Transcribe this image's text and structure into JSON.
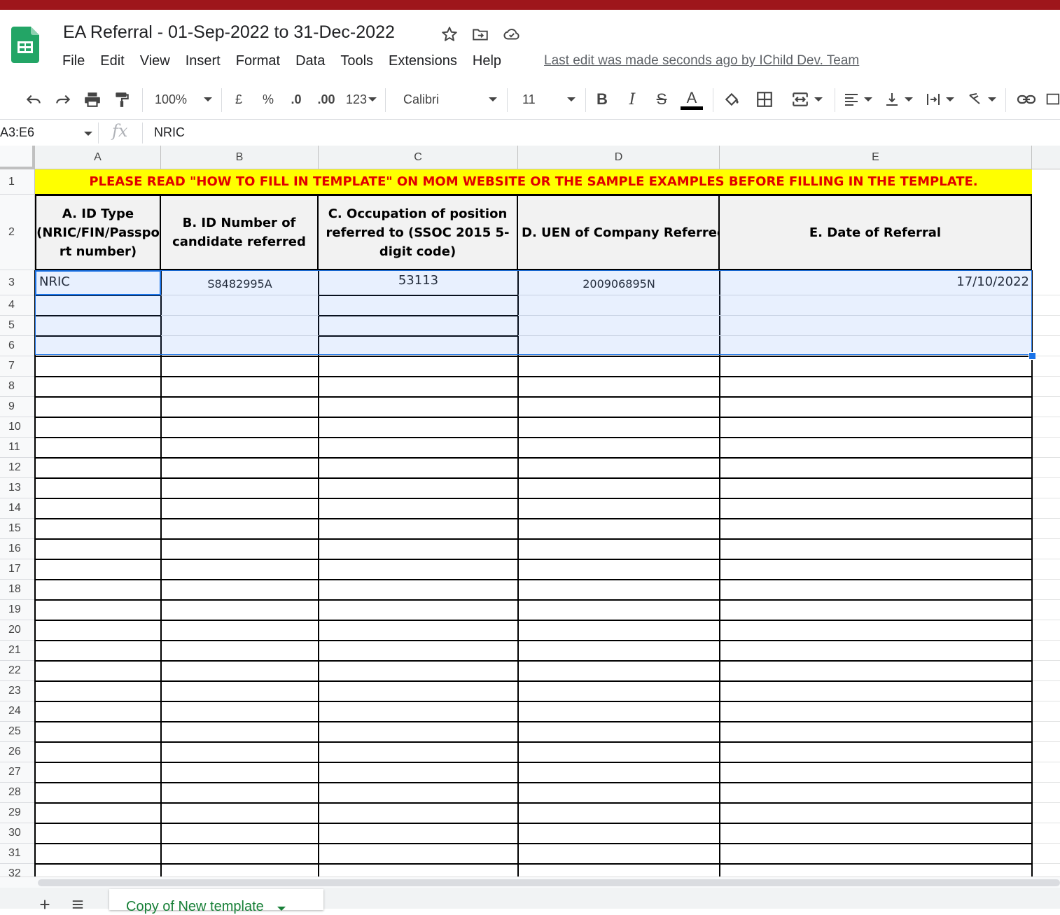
{
  "app": {
    "title": "EA Referral - 01-Sep-2022 to 31-Dec-2022",
    "last_edit": "Last edit was made seconds ago by IChild Dev. Team"
  },
  "menu": [
    "File",
    "Edit",
    "View",
    "Insert",
    "Format",
    "Data",
    "Tools",
    "Extensions",
    "Help"
  ],
  "toolbar": {
    "zoom": "100%",
    "currency": "£",
    "percent": "%",
    "decrease_decimal": ".0",
    "increase_decimal": ".00",
    "more_formats": "123",
    "font": "Calibri",
    "font_size": "11",
    "bold": "B",
    "italic": "I",
    "strike": "S",
    "text_color": "A",
    "text_color_value": "#000000"
  },
  "formula_bar": {
    "name_box": "A3:E6",
    "fx": "fx",
    "value": "NRIC"
  },
  "columns": [
    "A",
    "B",
    "C",
    "D",
    "E"
  ],
  "rows": [
    "1",
    "2",
    "3",
    "4",
    "5",
    "6",
    "7",
    "8",
    "9",
    "10",
    "11",
    "12",
    "13",
    "14",
    "15",
    "16",
    "17",
    "18",
    "19",
    "20",
    "21",
    "22",
    "23",
    "24",
    "25",
    "26",
    "27",
    "28",
    "29",
    "30",
    "31",
    "32"
  ],
  "sheet": {
    "banner": "PLEASE READ \"HOW TO FILL IN TEMPLATE\" ON MOM WEBSITE OR THE SAMPLE EXAMPLES BEFORE FILLING IN THE TEMPLATE.",
    "headers": {
      "a": "A. ID Type (NRIC/FIN/Passpo rt number)",
      "b": "B. ID Number of candidate referred",
      "c": "C. Occupation of position referred to (SSOC 2015 5-digit code)",
      "d": "D. UEN of Company Referred to",
      "e": "E. Date of Referral"
    },
    "row3": {
      "a": "NRIC",
      "b": "S8482995A",
      "c": "53113",
      "d": "200906895N",
      "e": "17/10/2022"
    }
  },
  "sheet_tab": {
    "label": "Copy of New template"
  },
  "colors": {
    "brand_bar": "#9e161b",
    "banner_bg": "#ffff00",
    "banner_text": "#e00000",
    "selection": "#1a73e8",
    "sheet_tab_text": "#188038"
  }
}
